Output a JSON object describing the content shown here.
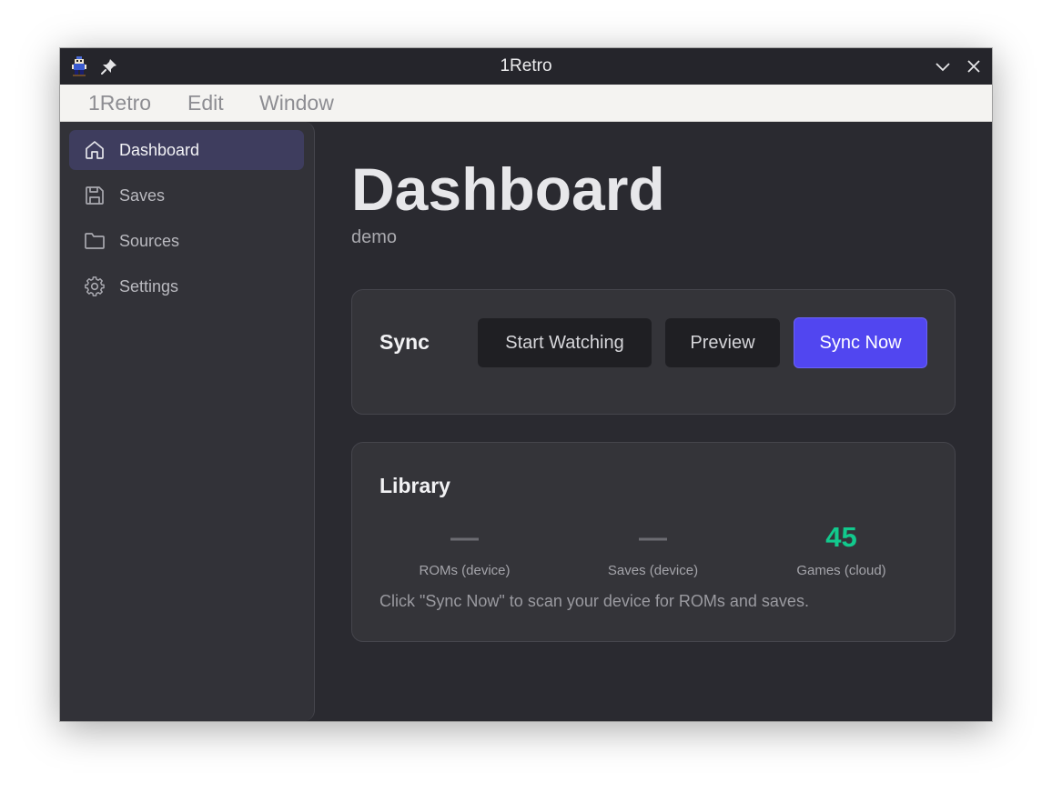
{
  "window": {
    "title": "1Retro"
  },
  "icons": {
    "app": "pixel-character-icon",
    "pin": "pin-icon",
    "minimize": "chevron-down-icon",
    "close": "close-icon"
  },
  "menubar": {
    "items": [
      "1Retro",
      "Edit",
      "Window"
    ]
  },
  "sidebar": {
    "items": [
      {
        "label": "Dashboard",
        "icon": "home-icon",
        "active": true
      },
      {
        "label": "Saves",
        "icon": "save-icon",
        "active": false
      },
      {
        "label": "Sources",
        "icon": "folder-icon",
        "active": false
      },
      {
        "label": "Settings",
        "icon": "gear-icon",
        "active": false
      }
    ]
  },
  "main": {
    "title": "Dashboard",
    "subtitle": "demo",
    "sync": {
      "title": "Sync",
      "start_watching_label": "Start Watching",
      "preview_label": "Preview",
      "sync_now_label": "Sync Now"
    },
    "library": {
      "title": "Library",
      "stats": [
        {
          "value": "—",
          "label": "ROMs (device)"
        },
        {
          "value": "—",
          "label": "Saves (device)"
        },
        {
          "value": "45",
          "label": "Games (cloud)"
        }
      ],
      "hint": "Click \"Sync Now\" to scan your device for ROMs and saves."
    }
  },
  "colors": {
    "accent": "#5146f0",
    "success": "#12c98d",
    "active_nav": "#3e3d5e"
  }
}
